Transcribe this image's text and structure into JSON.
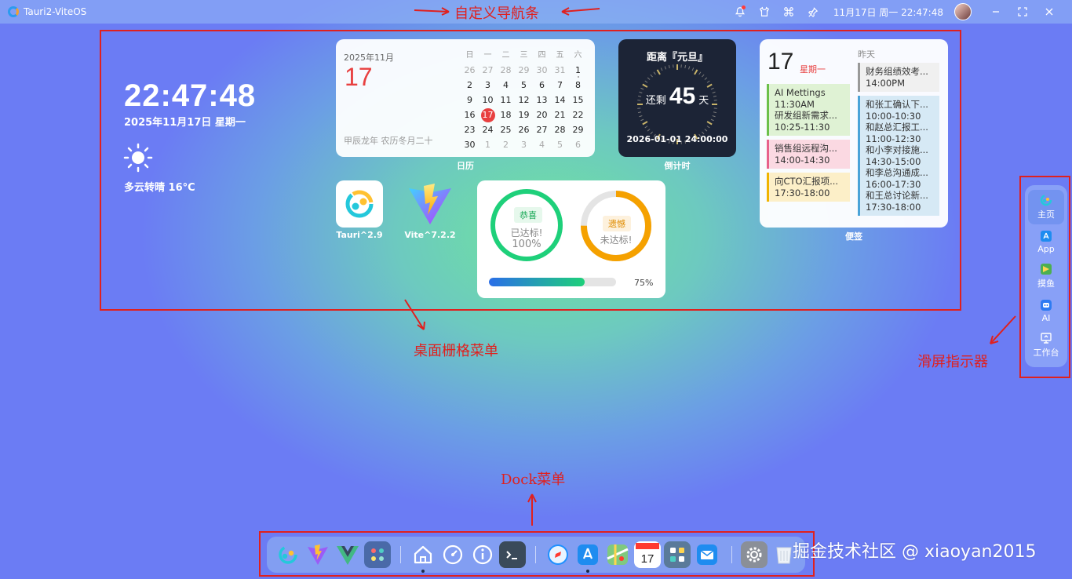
{
  "titlebar": {
    "app_title": "Tauri2-ViteOS",
    "clock": "11月17日 周一 22:47:48",
    "icons": [
      "bell-icon",
      "shirt-icon",
      "command-icon",
      "pin-icon"
    ],
    "window_buttons": [
      "minimize-icon",
      "fullscreen-icon",
      "close-icon"
    ]
  },
  "annotations": {
    "navbar": "自定义导航条",
    "grid": "桌面栅格菜单",
    "indicator": "滑屏指示器",
    "dock": "Dock菜单",
    "color": "#e0201e"
  },
  "clock_widget": {
    "time": "22:47:48",
    "date": "2025年11月17日 星期一",
    "weather": "多云转晴 16°C"
  },
  "calendar": {
    "year_month": "2025年11月",
    "day": "17",
    "lunar": "甲辰龙年 农历冬月二十",
    "label": "日历",
    "weekdays": [
      "日",
      "一",
      "二",
      "三",
      "四",
      "五",
      "六"
    ],
    "weeks": [
      [
        "26",
        "27",
        "28",
        "29",
        "30",
        "31",
        "1"
      ],
      [
        "2",
        "3",
        "4",
        "5",
        "6",
        "7",
        "8"
      ],
      [
        "9",
        "10",
        "11",
        "12",
        "13",
        "14",
        "15"
      ],
      [
        "16",
        "17",
        "18",
        "19",
        "20",
        "21",
        "22"
      ],
      [
        "23",
        "24",
        "25",
        "26",
        "27",
        "28",
        "29"
      ],
      [
        "30",
        "1",
        "2",
        "3",
        "4",
        "5",
        "6"
      ]
    ],
    "today": "17"
  },
  "countdown": {
    "title": "距离『元旦』",
    "prefix": "还剩",
    "days": "45",
    "suffix": "天",
    "target": "2026-01-01 24:00:00",
    "label": "倒计时"
  },
  "notes": {
    "day": "17",
    "weekday": "星期一",
    "yesterday": "昨天",
    "label": "便签",
    "today_items": [
      {
        "text": "AI Mettings\n11:30AM\n研发组新需求...\n10:25-11:30",
        "color": "green"
      },
      {
        "text": "销售组远程沟...\n14:00-14:30",
        "color": "pink"
      },
      {
        "text": "向CTO汇报项...\n17:30-18:00",
        "color": "yellow"
      }
    ],
    "yesterday_items": [
      {
        "text": "财务组绩效考...\n14:00PM",
        "color": "gray"
      },
      {
        "text": "和张工确认下...\n10:00-10:30\n和赵总汇报工...\n11:00-12:30\n和小李对接施...\n14:30-15:00\n和李总沟通成...\n16:00-17:30\n和王总讨论新...\n17:30-18:00",
        "color": "blue"
      }
    ]
  },
  "apps": [
    {
      "label": "Tauri^2.9",
      "icon": "tauri-icon"
    },
    {
      "label": "Vite^7.2.2",
      "icon": "vite-icon"
    }
  ],
  "progress": {
    "ring1": {
      "badge": "恭喜",
      "line1": "已达标!",
      "line2": "100%",
      "value": 1.0,
      "color": "#1ed07a"
    },
    "ring2": {
      "badge": "遗憾",
      "line1": "未达标!",
      "value": 0.75,
      "color": "#f5a100"
    },
    "bar_value": 0.75,
    "bar_label": "75%"
  },
  "side_nav": {
    "items": [
      {
        "label": "主页",
        "icon": "home-icon",
        "active": true
      },
      {
        "label": "App",
        "icon": "appstore-icon",
        "active": false
      },
      {
        "label": "摸鱼",
        "icon": "fish-icon",
        "active": false
      },
      {
        "label": "AI",
        "icon": "ai-robot-icon",
        "active": false
      },
      {
        "label": "工作台",
        "icon": "monitor-icon",
        "active": false
      }
    ]
  },
  "dock": {
    "items": [
      "tauri-icon",
      "vite-icon",
      "vue-icon",
      "launchpad-icon",
      "home-icon",
      "dashboard-icon",
      "info-icon",
      "terminal-icon",
      "safari-icon",
      "appstore-icon",
      "maps-icon",
      "calendar-icon",
      "widgets-icon",
      "mail-icon",
      "settings-icon",
      "trash-icon"
    ],
    "running": [
      "home-icon",
      "appstore-icon"
    ]
  },
  "watermark": "掘金技术社区 @ xiaoyan2015"
}
